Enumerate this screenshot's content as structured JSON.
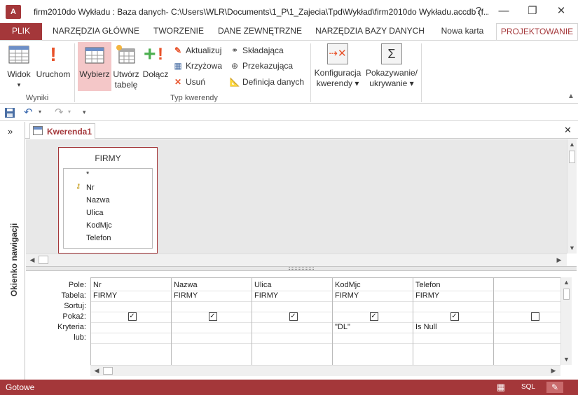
{
  "window": {
    "app_icon": "A",
    "title": "firm2010do Wykładu : Baza danych- C:\\Users\\WLR\\Documents\\1_P\\1_Zajecia\\Tpd\\Wykład\\firm2010do Wykładu.accdb (f...",
    "help": "?",
    "minimize": "—",
    "restore": "❐",
    "close": "✕"
  },
  "tabs": [
    "PLIK",
    "NARZĘDZIA GŁÓWNE",
    "TWORZENIE",
    "DANE ZEWNĘTRZNE",
    "NARZĘDZIA BAZY DANYCH",
    "Nowa karta",
    "PROJEKTOWANIE"
  ],
  "ribbon": {
    "groups": {
      "results": "Wyniki",
      "query_type": "Typ kwerendy"
    },
    "view": {
      "line1": "Widok",
      "arrow": "▾"
    },
    "run": {
      "line1": "Uruchom"
    },
    "select": {
      "line1": "Wybierz"
    },
    "make_table": {
      "line1": "Utwórz",
      "line2": "tabelę"
    },
    "append": {
      "line1": "Dołącz"
    },
    "update": "Aktualizuj",
    "crosstab": "Krzyżowa",
    "delete": "Usuń",
    "union": "Składająca",
    "pass_through": "Przekazująca",
    "data_definition": "Definicja danych",
    "setup": {
      "line1": "Konfiguracja",
      "line2": "kwerendy ▾"
    },
    "show_hide": {
      "line1": "Pokazywanie/",
      "line2": "ukrywanie ▾"
    }
  },
  "qat": {
    "undo_arrow": "▾",
    "redo_arrow": "▾",
    "customize": "▾"
  },
  "nav_pane": {
    "toggle": "»",
    "label": "Okienko nawigacji"
  },
  "doc_tab": {
    "title": "Kwerenda1",
    "close": "✕"
  },
  "table": {
    "name": "FIRMY",
    "fields": [
      "*",
      "Nr",
      "Nazwa",
      "Ulica",
      "KodMjc",
      "Telefon"
    ]
  },
  "grid": {
    "row_labels": [
      "Pole:",
      "Tabela:",
      "Sortuj:",
      "Pokaż:",
      "Kryteria:",
      "lub:"
    ],
    "columns": [
      {
        "field": "Nr",
        "table": "FIRMY",
        "sort": "",
        "show": true,
        "criteria": "",
        "or": ""
      },
      {
        "field": "Nazwa",
        "table": "FIRMY",
        "sort": "",
        "show": true,
        "criteria": "",
        "or": ""
      },
      {
        "field": "Ulica",
        "table": "FIRMY",
        "sort": "",
        "show": true,
        "criteria": "",
        "or": ""
      },
      {
        "field": "KodMjc",
        "table": "FIRMY",
        "sort": "",
        "show": true,
        "criteria": "\"DL\"",
        "or": ""
      },
      {
        "field": "Telefon",
        "table": "FIRMY",
        "sort": "",
        "show": true,
        "criteria": "Is Null",
        "or": ""
      },
      {
        "field": "",
        "table": "",
        "sort": "",
        "show": false,
        "criteria": "",
        "or": ""
      }
    ]
  },
  "status": {
    "text": "Gotowe",
    "sql": "SQL"
  },
  "colors": {
    "accent": "#a4373a"
  }
}
